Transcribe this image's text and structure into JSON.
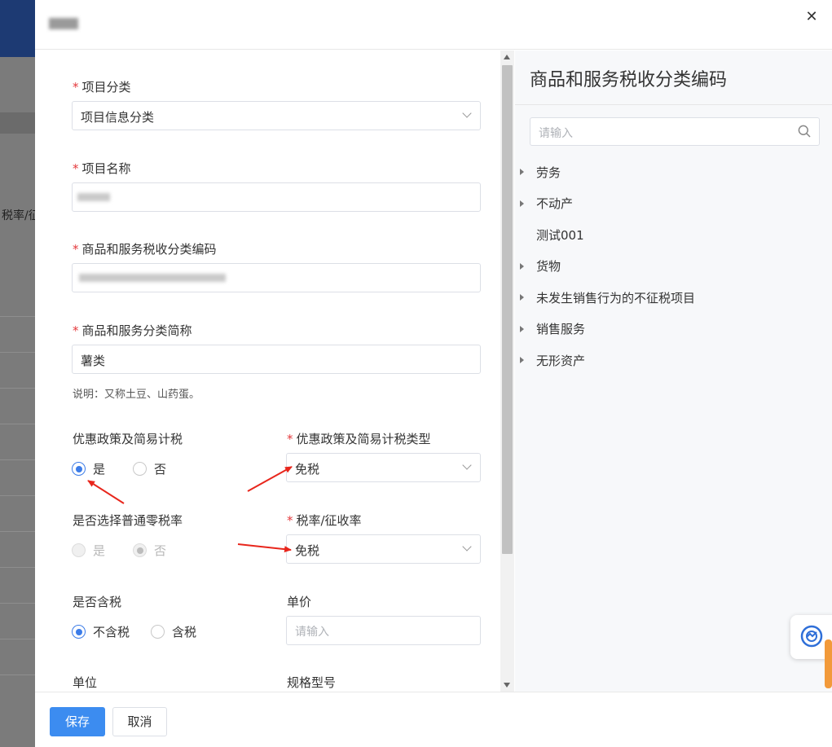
{
  "background": {
    "partial_label": "税率/征"
  },
  "form": {
    "category": {
      "label": "项目分类",
      "value": "项目信息分类"
    },
    "name": {
      "label": "项目名称"
    },
    "tax_code": {
      "label": "商品和服务税收分类编码"
    },
    "short_name": {
      "label": "商品和服务分类简称",
      "value": "薯类",
      "note": "说明：又称土豆、山药蛋。"
    },
    "preferential": {
      "label": "优惠政策及简易计税",
      "options": [
        "是",
        "否"
      ],
      "selected": "是"
    },
    "preferential_type": {
      "label": "优惠政策及简易计税类型",
      "value": "免税"
    },
    "zero_rate": {
      "label": "是否选择普通零税率",
      "options": [
        "是",
        "否"
      ],
      "selected": "否",
      "disabled": true
    },
    "tax_rate": {
      "label": "税率/征收率",
      "value": "免税"
    },
    "tax_included": {
      "label": "是否含税",
      "options": [
        "不含税",
        "含税"
      ],
      "selected": "不含税"
    },
    "unit_price": {
      "label": "单价",
      "placeholder": "请输入"
    },
    "unit": {
      "label": "单位"
    },
    "spec": {
      "label": "规格型号"
    }
  },
  "panel": {
    "title": "商品和服务税收分类编码",
    "search_placeholder": "请输入",
    "tree": [
      {
        "label": "劳务",
        "has_children": true
      },
      {
        "label": "不动产",
        "has_children": true
      },
      {
        "label": "测试001",
        "has_children": false
      },
      {
        "label": "货物",
        "has_children": true
      },
      {
        "label": "未发生销售行为的不征税项目",
        "has_children": true
      },
      {
        "label": "销售服务",
        "has_children": true
      },
      {
        "label": "无形资产",
        "has_children": true
      }
    ]
  },
  "footer": {
    "save_label": "保存",
    "cancel_label": "取消"
  },
  "icons": {
    "close": "close-icon",
    "search": "search-icon",
    "widget": "assistant-icon"
  },
  "colors": {
    "primary": "#3c8cf0",
    "radio_checked": "#3c7ce8",
    "required": "#e4393c",
    "annotation_arrow": "#e8261c"
  }
}
